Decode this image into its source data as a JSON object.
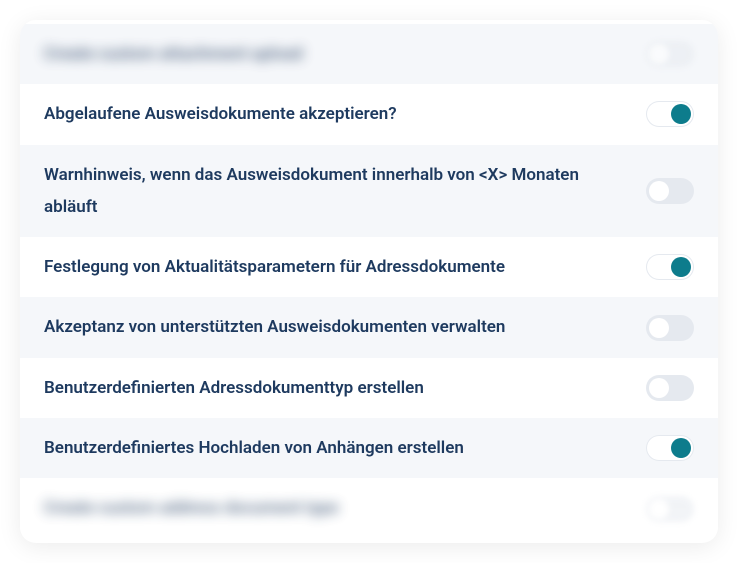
{
  "settings": [
    {
      "label": "Create custom attachment upload",
      "enabled": false,
      "blurred": true
    },
    {
      "label": "Abgelaufene Ausweisdokumente akzeptieren?",
      "enabled": true,
      "blurred": false
    },
    {
      "label": "Warnhinweis, wenn das Ausweisdokument innerhalb von <X> Monaten abläuft",
      "enabled": false,
      "blurred": false
    },
    {
      "label": "Festlegung von Aktualitätsparametern für Adressdokumente",
      "enabled": true,
      "blurred": false
    },
    {
      "label": "Akzeptanz von unterstützten Ausweisdokumenten verwalten",
      "enabled": false,
      "blurred": false
    },
    {
      "label": "Benutzerdefinierten Adressdokumenttyp erstellen",
      "enabled": false,
      "blurred": false
    },
    {
      "label": "Benutzerdefiniertes Hochladen von Anhängen erstellen",
      "enabled": true,
      "blurred": false
    },
    {
      "label": "Create custom address document type",
      "enabled": false,
      "blurred": true
    }
  ]
}
